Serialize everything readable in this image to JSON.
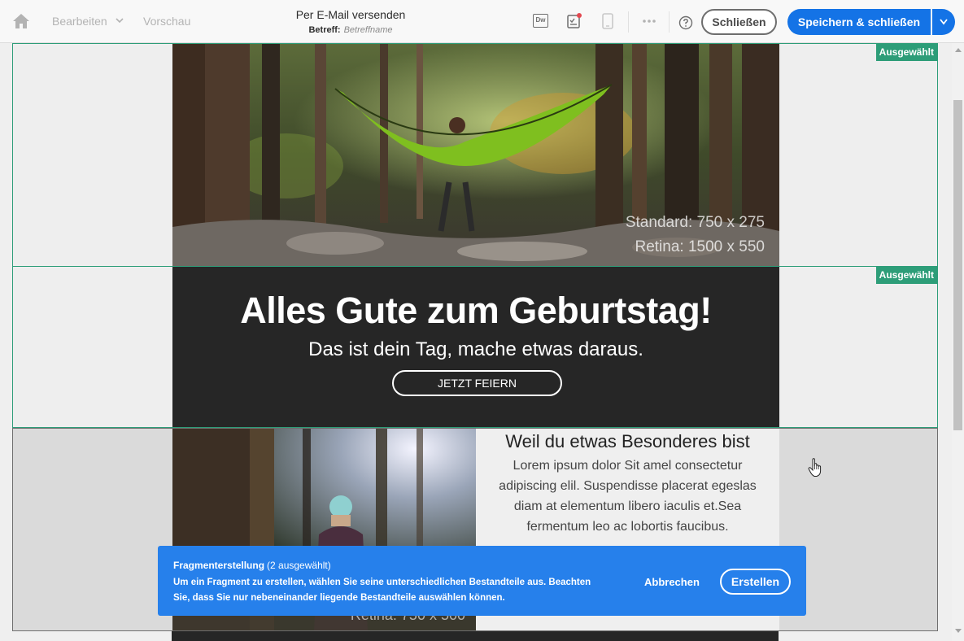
{
  "header": {
    "nav_edit": "Bearbeiten",
    "nav_preview": "Vorschau",
    "title": "Per E-Mail versenden",
    "subject_label": "Betreff:",
    "subject_placeholder": "Betreffname",
    "dw_icon_text": "Dw",
    "close_label": "Schließen",
    "save_label": "Speichern & schließen"
  },
  "sections": {
    "selected_badge": "Ausgewählt",
    "hero_image": {
      "caption_standard": "Standard: 750 x 275",
      "caption_retina": "Retina: 1500 x 550"
    },
    "banner": {
      "headline": "Alles Gute zum Geburtstag!",
      "tagline": "Das ist dein Tag, mache etwas daraus.",
      "cta_label": "JETZT FEIERN"
    },
    "content": {
      "heading": "Weil du etwas Besonderes bist",
      "body": "Lorem ipsum dolor Sit amel consectetur adipiscing elil. Suspendisse placerat egeslas diam at elementum libero iaculis et.Sea fermentum leo ac lobortis faucibus.",
      "image_caption": "Retina: 750 x 500"
    }
  },
  "toast": {
    "title": "Fragmenterstellung",
    "count": "(2 ausgewählt)",
    "message": "Um ein Fragment zu erstellen, wählen Sie seine unterschiedlichen Bestandteile aus. Beachten Sie, dass Sie nur nebeneinander liegende Bestandteile auswählen können.",
    "cancel_label": "Abbrechen",
    "create_label": "Erstellen"
  },
  "colors": {
    "accent_blue": "#1473e6",
    "toast_blue": "#2680eb",
    "selected_green": "#2d9d78",
    "banner_dark": "#262626"
  },
  "icons": [
    "home-icon",
    "chevron-down-icon",
    "dreamweaver-icon",
    "checklist-icon",
    "mobile-icon",
    "more-icon",
    "help-icon",
    "hand-cursor-icon"
  ]
}
